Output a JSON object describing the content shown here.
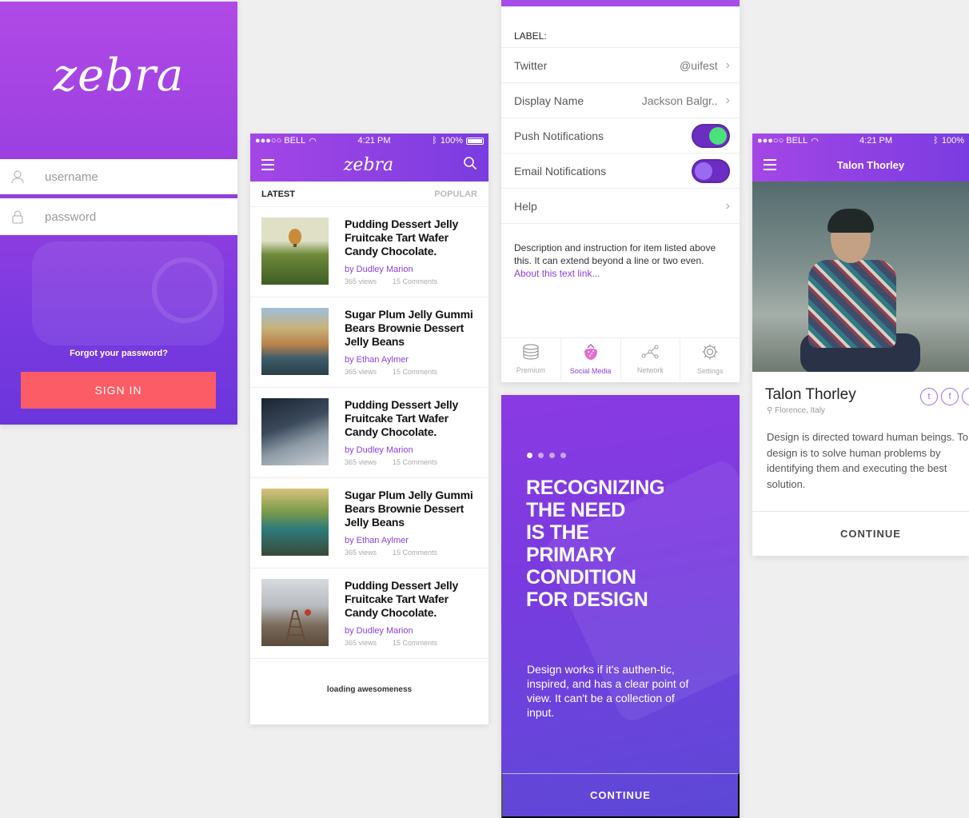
{
  "login": {
    "logo": "zebra",
    "username_placeholder": "username",
    "password_placeholder": "password",
    "forgot": "Forgot your password?",
    "signin": "SIGN IN",
    "accent": "#fc5c65"
  },
  "status": {
    "carrier": "●●●○○ BELL",
    "time": "4:21 PM",
    "battery": "100%"
  },
  "feed": {
    "logo": "zebra",
    "tabs": {
      "latest": "LATEST",
      "popular": "POPULAR"
    },
    "articles": [
      {
        "title": "Pudding Dessert Jelly Fruitcake Tart Wafer Candy Chocolate.",
        "author": "by Dudley Marion",
        "views": "365 views",
        "comments": "15 Comments"
      },
      {
        "title": "Sugar Plum Jelly Gummi Bears Brownie Dessert Jelly Beans",
        "author": "by Ethan Aylmer",
        "views": "365 views",
        "comments": "15 Comments"
      },
      {
        "title": "Pudding Dessert Jelly Fruitcake Tart Wafer Candy Chocolate.",
        "author": "by Dudley Marion",
        "views": "365 views",
        "comments": "15 Comments"
      },
      {
        "title": "Sugar Plum Jelly Gummi Bears Brownie Dessert Jelly Beans",
        "author": "by Ethan Aylmer",
        "views": "365 views",
        "comments": "15 Comments"
      },
      {
        "title": "Pudding Dessert Jelly Fruitcake Tart Wafer Candy Chocolate.",
        "author": "by Dudley Marion",
        "views": "365 views",
        "comments": "15 Comments"
      }
    ],
    "loading": "loading awesomeness"
  },
  "settings": {
    "section_label": "LABEL:",
    "rows": [
      {
        "label": "Twitter",
        "value": "@uifest"
      },
      {
        "label": "Display Name",
        "value": "Jackson Balgr.."
      },
      {
        "label": "Push Notifications",
        "toggle": "on"
      },
      {
        "label": "Email Notifications",
        "toggle": "off"
      },
      {
        "label": "Help",
        "value": ""
      }
    ],
    "description": "Description and instruction for item listed above this. It can extend beyond a line or two even.",
    "link": "About this text link...",
    "tabs": [
      "Premium",
      "Social Media",
      "Network",
      "Settings"
    ],
    "active_tab": "Social Media",
    "toggle_on_color": "#4ce07a"
  },
  "onboarding": {
    "headline": [
      "RECOGNIZING",
      "THE NEED",
      "IS THE",
      "PRIMARY",
      "CONDITION",
      "FOR DESIGN"
    ],
    "body": "Design works if it's authen-tic, inspired, and has a clear point of view. It can't be a collection of input.",
    "continue": "CONTINUE",
    "pages": 4,
    "current_page": 1
  },
  "profile": {
    "nav_title": "Talon Thorley",
    "name": "Talon Thorley",
    "location": "Florence, Italy",
    "bio": "Design is directed toward human beings. To design is to solve human problems by identifying them and executing the best solution.",
    "social_icons": [
      "twitter-icon",
      "facebook-icon",
      "instagram-icon"
    ],
    "continue": "CONTINUE"
  }
}
